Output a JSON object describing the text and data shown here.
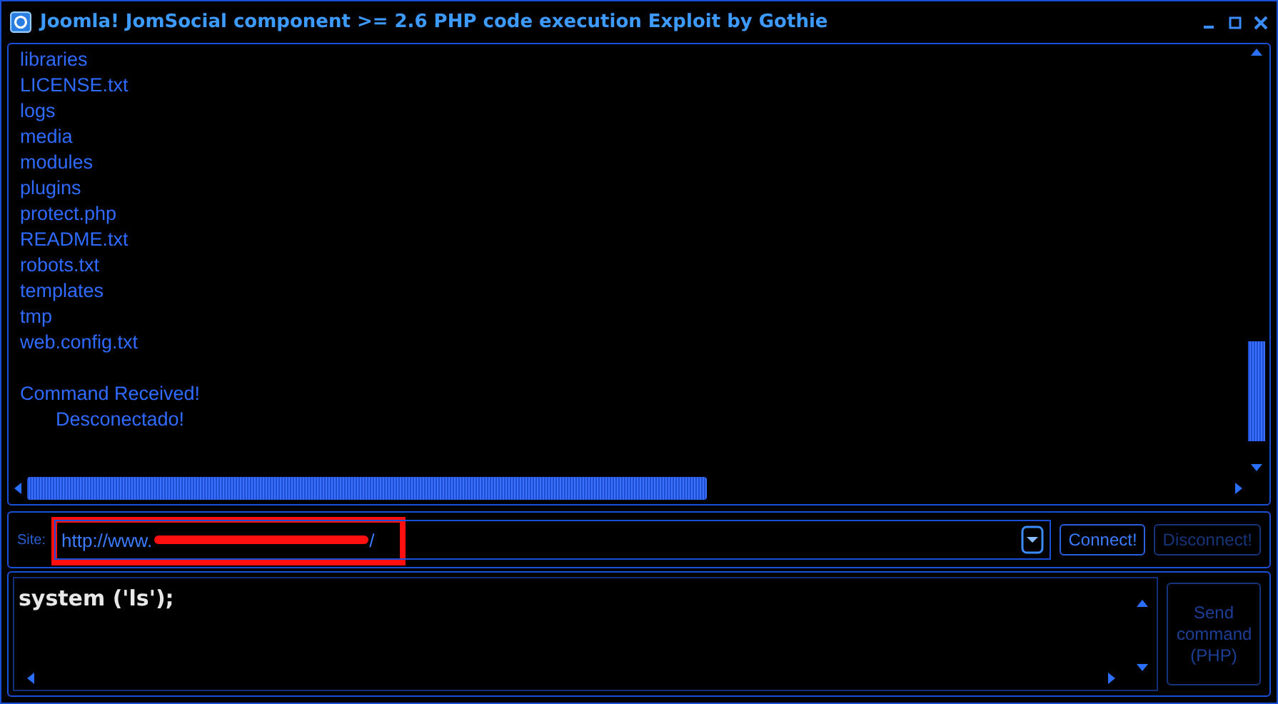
{
  "window": {
    "title": "Joomla! JomSocial component >= 2.6 PHP code execution Exploit by Gothie"
  },
  "output": {
    "files": [
      "libraries",
      "LICENSE.txt",
      "logs",
      "media",
      "modules",
      "plugins",
      "protect.php",
      "README.txt",
      "robots.txt",
      "templates",
      "tmp",
      "web.config.txt"
    ],
    "status": "Command Received!",
    "status_detail": "Desconectado!"
  },
  "site": {
    "label": "Site:",
    "value_start": "http://www.",
    "value_end": "/",
    "redacted": true,
    "highlighted": true
  },
  "buttons": [
    {
      "label": "Connect!",
      "disabled": false
    },
    {
      "label": "Disconnect!",
      "disabled": true
    }
  ],
  "command": {
    "value": "system ('ls');"
  },
  "send_button": {
    "label": "Send command (PHP)",
    "disabled": true
  }
}
